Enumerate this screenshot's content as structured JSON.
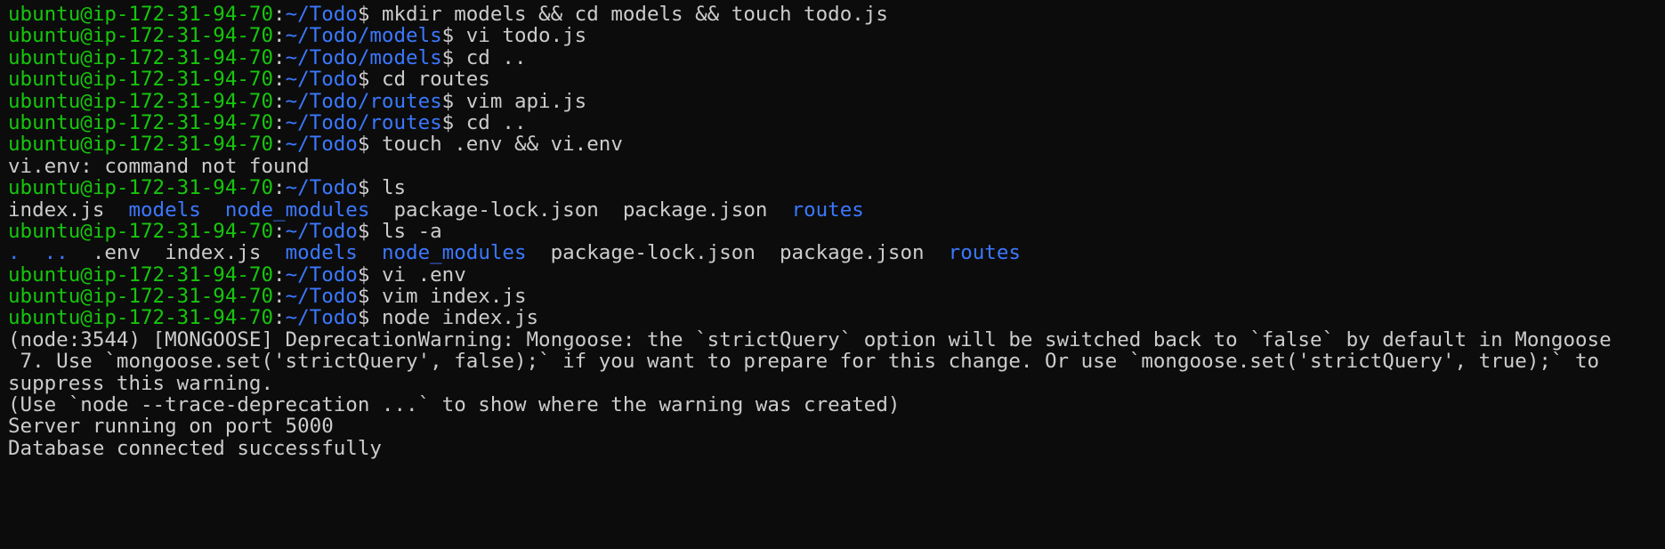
{
  "terminal": {
    "background": "#0c0c0c",
    "colors": {
      "text": "#cccccc",
      "user": "#16c60c",
      "path": "#3b78ff",
      "directory": "#3b78ff"
    },
    "user_host": "ubuntu@ip-172-31-94-70",
    "lines": [
      {
        "type": "prompt",
        "path": "~/Todo",
        "command": "mkdir models && cd models && touch todo.js"
      },
      {
        "type": "prompt",
        "path": "~/Todo/models",
        "command": "vi todo.js"
      },
      {
        "type": "prompt",
        "path": "~/Todo/models",
        "command": "cd .."
      },
      {
        "type": "prompt",
        "path": "~/Todo",
        "command": "cd routes"
      },
      {
        "type": "prompt",
        "path": "~/Todo/routes",
        "command": "vim api.js"
      },
      {
        "type": "prompt",
        "path": "~/Todo/routes",
        "command": "cd .."
      },
      {
        "type": "prompt",
        "path": "~/Todo",
        "command": "touch .env && vi.env"
      },
      {
        "type": "output",
        "text": "vi.env: command not found"
      },
      {
        "type": "prompt",
        "path": "~/Todo",
        "command": "ls"
      },
      {
        "type": "listing",
        "items": [
          {
            "name": "index.js",
            "kind": "file"
          },
          {
            "name": "models",
            "kind": "dir"
          },
          {
            "name": "node_modules",
            "kind": "dir"
          },
          {
            "name": "package-lock.json",
            "kind": "file"
          },
          {
            "name": "package.json",
            "kind": "file"
          },
          {
            "name": "routes",
            "kind": "dir"
          }
        ]
      },
      {
        "type": "prompt",
        "path": "~/Todo",
        "command": "ls -a"
      },
      {
        "type": "listing",
        "items": [
          {
            "name": ".",
            "kind": "dir"
          },
          {
            "name": "..",
            "kind": "dir"
          },
          {
            "name": ".env",
            "kind": "file"
          },
          {
            "name": "index.js",
            "kind": "file"
          },
          {
            "name": "models",
            "kind": "dir"
          },
          {
            "name": "node_modules",
            "kind": "dir"
          },
          {
            "name": "package-lock.json",
            "kind": "file"
          },
          {
            "name": "package.json",
            "kind": "file"
          },
          {
            "name": "routes",
            "kind": "dir"
          }
        ]
      },
      {
        "type": "prompt",
        "path": "~/Todo",
        "command": "vi .env"
      },
      {
        "type": "prompt",
        "path": "~/Todo",
        "command": "vim index.js"
      },
      {
        "type": "prompt",
        "path": "~/Todo",
        "command": "node index.js"
      },
      {
        "type": "output",
        "text": "(node:3544) [MONGOOSE] DeprecationWarning: Mongoose: the `strictQuery` option will be switched back to `false` by default in Mongoose"
      },
      {
        "type": "output",
        "text": " 7. Use `mongoose.set('strictQuery', false);` if you want to prepare for this change. Or use `mongoose.set('strictQuery', true);` to"
      },
      {
        "type": "output",
        "text": "suppress this warning."
      },
      {
        "type": "output",
        "text": "(Use `node --trace-deprecation ...` to show where the warning was created)"
      },
      {
        "type": "output",
        "text": "Server running on port 5000"
      },
      {
        "type": "output",
        "text": "Database connected successfully"
      }
    ]
  }
}
